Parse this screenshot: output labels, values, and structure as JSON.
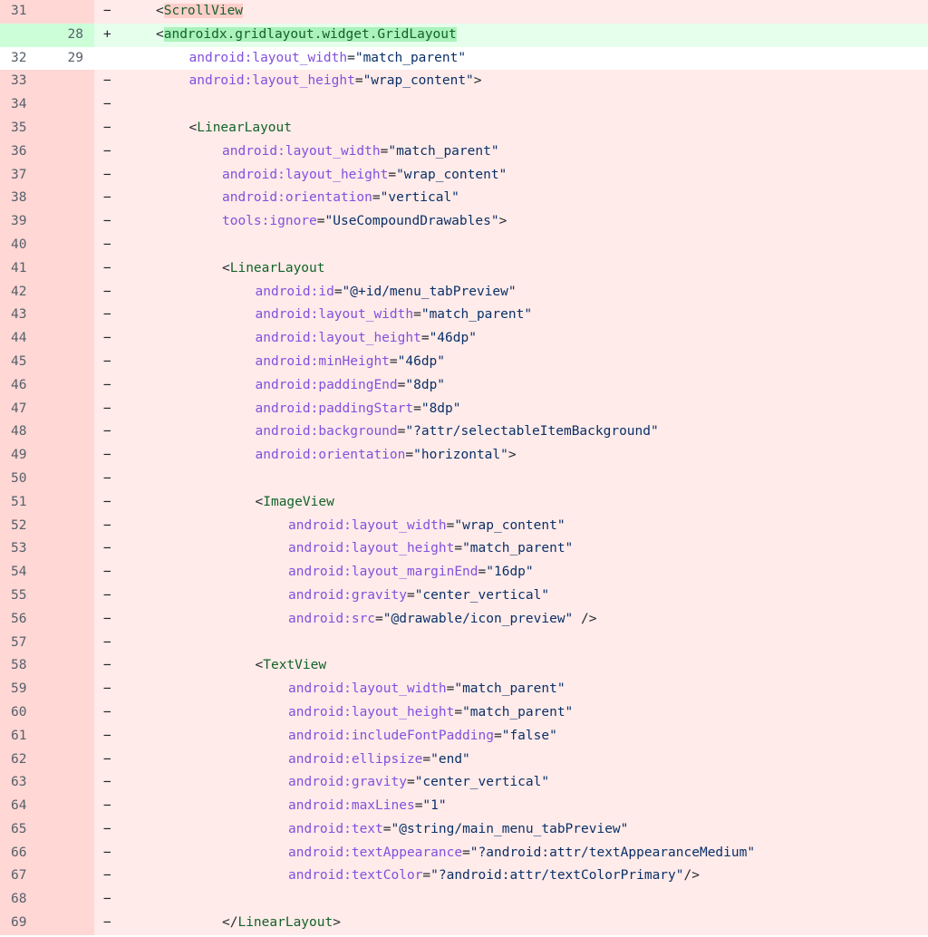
{
  "lines": [
    {
      "old": "31",
      "new": "",
      "type": "del",
      "sign": "−",
      "indent": 1,
      "kind": "tagopen",
      "tag": "ScrollView",
      "highlight": true
    },
    {
      "old": "",
      "new": "28",
      "type": "add",
      "sign": "+",
      "indent": 1,
      "kind": "tagopen",
      "tag": "androidx.gridlayout.widget.GridLayout",
      "highlight": true
    },
    {
      "old": "32",
      "new": "29",
      "type": "ctx",
      "sign": "",
      "indent": 2,
      "kind": "attr",
      "attr": "android:layout_width",
      "value": "\"match_parent\"",
      "tail": ""
    },
    {
      "old": "33",
      "new": "",
      "type": "del",
      "sign": "−",
      "indent": 2,
      "kind": "attr",
      "attr": "android:layout_height",
      "value": "\"wrap_content\"",
      "tail": ">"
    },
    {
      "old": "34",
      "new": "",
      "type": "del",
      "sign": "−",
      "indent": 0,
      "kind": "blank"
    },
    {
      "old": "35",
      "new": "",
      "type": "del",
      "sign": "−",
      "indent": 2,
      "kind": "tagopen",
      "tag": "LinearLayout"
    },
    {
      "old": "36",
      "new": "",
      "type": "del",
      "sign": "−",
      "indent": 3,
      "kind": "attr",
      "attr": "android:layout_width",
      "value": "\"match_parent\"",
      "tail": ""
    },
    {
      "old": "37",
      "new": "",
      "type": "del",
      "sign": "−",
      "indent": 3,
      "kind": "attr",
      "attr": "android:layout_height",
      "value": "\"wrap_content\"",
      "tail": ""
    },
    {
      "old": "38",
      "new": "",
      "type": "del",
      "sign": "−",
      "indent": 3,
      "kind": "attr",
      "attr": "android:orientation",
      "value": "\"vertical\"",
      "tail": ""
    },
    {
      "old": "39",
      "new": "",
      "type": "del",
      "sign": "−",
      "indent": 3,
      "kind": "attr",
      "attr": "tools:ignore",
      "value": "\"UseCompoundDrawables\"",
      "tail": ">"
    },
    {
      "old": "40",
      "new": "",
      "type": "del",
      "sign": "−",
      "indent": 0,
      "kind": "blank"
    },
    {
      "old": "41",
      "new": "",
      "type": "del",
      "sign": "−",
      "indent": 3,
      "kind": "tagopen",
      "tag": "LinearLayout"
    },
    {
      "old": "42",
      "new": "",
      "type": "del",
      "sign": "−",
      "indent": 4,
      "kind": "attr",
      "attr": "android:id",
      "value": "\"@+id/menu_tabPreview\"",
      "tail": ""
    },
    {
      "old": "43",
      "new": "",
      "type": "del",
      "sign": "−",
      "indent": 4,
      "kind": "attr",
      "attr": "android:layout_width",
      "value": "\"match_parent\"",
      "tail": ""
    },
    {
      "old": "44",
      "new": "",
      "type": "del",
      "sign": "−",
      "indent": 4,
      "kind": "attr",
      "attr": "android:layout_height",
      "value": "\"46dp\"",
      "tail": ""
    },
    {
      "old": "45",
      "new": "",
      "type": "del",
      "sign": "−",
      "indent": 4,
      "kind": "attr",
      "attr": "android:minHeight",
      "value": "\"46dp\"",
      "tail": ""
    },
    {
      "old": "46",
      "new": "",
      "type": "del",
      "sign": "−",
      "indent": 4,
      "kind": "attr",
      "attr": "android:paddingEnd",
      "value": "\"8dp\"",
      "tail": ""
    },
    {
      "old": "47",
      "new": "",
      "type": "del",
      "sign": "−",
      "indent": 4,
      "kind": "attr",
      "attr": "android:paddingStart",
      "value": "\"8dp\"",
      "tail": ""
    },
    {
      "old": "48",
      "new": "",
      "type": "del",
      "sign": "−",
      "indent": 4,
      "kind": "attr",
      "attr": "android:background",
      "value": "\"?attr/selectableItemBackground\"",
      "tail": ""
    },
    {
      "old": "49",
      "new": "",
      "type": "del",
      "sign": "−",
      "indent": 4,
      "kind": "attr",
      "attr": "android:orientation",
      "value": "\"horizontal\"",
      "tail": ">"
    },
    {
      "old": "50",
      "new": "",
      "type": "del",
      "sign": "−",
      "indent": 0,
      "kind": "blank"
    },
    {
      "old": "51",
      "new": "",
      "type": "del",
      "sign": "−",
      "indent": 4,
      "kind": "tagopen",
      "tag": "ImageView"
    },
    {
      "old": "52",
      "new": "",
      "type": "del",
      "sign": "−",
      "indent": 5,
      "kind": "attr",
      "attr": "android:layout_width",
      "value": "\"wrap_content\"",
      "tail": ""
    },
    {
      "old": "53",
      "new": "",
      "type": "del",
      "sign": "−",
      "indent": 5,
      "kind": "attr",
      "attr": "android:layout_height",
      "value": "\"match_parent\"",
      "tail": ""
    },
    {
      "old": "54",
      "new": "",
      "type": "del",
      "sign": "−",
      "indent": 5,
      "kind": "attr",
      "attr": "android:layout_marginEnd",
      "value": "\"16dp\"",
      "tail": ""
    },
    {
      "old": "55",
      "new": "",
      "type": "del",
      "sign": "−",
      "indent": 5,
      "kind": "attr",
      "attr": "android:gravity",
      "value": "\"center_vertical\"",
      "tail": ""
    },
    {
      "old": "56",
      "new": "",
      "type": "del",
      "sign": "−",
      "indent": 5,
      "kind": "attr",
      "attr": "android:src",
      "value": "\"@drawable/icon_preview\"",
      "tail": " />"
    },
    {
      "old": "57",
      "new": "",
      "type": "del",
      "sign": "−",
      "indent": 0,
      "kind": "blank"
    },
    {
      "old": "58",
      "new": "",
      "type": "del",
      "sign": "−",
      "indent": 4,
      "kind": "tagopen",
      "tag": "TextView"
    },
    {
      "old": "59",
      "new": "",
      "type": "del",
      "sign": "−",
      "indent": 5,
      "kind": "attr",
      "attr": "android:layout_width",
      "value": "\"match_parent\"",
      "tail": ""
    },
    {
      "old": "60",
      "new": "",
      "type": "del",
      "sign": "−",
      "indent": 5,
      "kind": "attr",
      "attr": "android:layout_height",
      "value": "\"match_parent\"",
      "tail": ""
    },
    {
      "old": "61",
      "new": "",
      "type": "del",
      "sign": "−",
      "indent": 5,
      "kind": "attr",
      "attr": "android:includeFontPadding",
      "value": "\"false\"",
      "tail": ""
    },
    {
      "old": "62",
      "new": "",
      "type": "del",
      "sign": "−",
      "indent": 5,
      "kind": "attr",
      "attr": "android:ellipsize",
      "value": "\"end\"",
      "tail": ""
    },
    {
      "old": "63",
      "new": "",
      "type": "del",
      "sign": "−",
      "indent": 5,
      "kind": "attr",
      "attr": "android:gravity",
      "value": "\"center_vertical\"",
      "tail": ""
    },
    {
      "old": "64",
      "new": "",
      "type": "del",
      "sign": "−",
      "indent": 5,
      "kind": "attr",
      "attr": "android:maxLines",
      "value": "\"1\"",
      "tail": ""
    },
    {
      "old": "65",
      "new": "",
      "type": "del",
      "sign": "−",
      "indent": 5,
      "kind": "attr",
      "attr": "android:text",
      "value": "\"@string/main_menu_tabPreview\"",
      "tail": ""
    },
    {
      "old": "66",
      "new": "",
      "type": "del",
      "sign": "−",
      "indent": 5,
      "kind": "attr",
      "attr": "android:textAppearance",
      "value": "\"?android:attr/textAppearanceMedium\"",
      "tail": ""
    },
    {
      "old": "67",
      "new": "",
      "type": "del",
      "sign": "−",
      "indent": 5,
      "kind": "attr",
      "attr": "android:textColor",
      "value": "\"?android:attr/textColorPrimary\"",
      "tail": "/>"
    },
    {
      "old": "68",
      "new": "",
      "type": "del",
      "sign": "−",
      "indent": 0,
      "kind": "blank"
    },
    {
      "old": "69",
      "new": "",
      "type": "del",
      "sign": "−",
      "indent": 3,
      "kind": "tagclose",
      "tag": "LinearLayout"
    }
  ],
  "colors": {
    "deleted_line": "#ffebe9",
    "deleted_gutter": "#ffd7d5",
    "added_line": "#e6ffec",
    "added_gutter": "#ccffd8",
    "attribute": "#8250df",
    "tag": "#116329",
    "value": "#0a3069"
  }
}
